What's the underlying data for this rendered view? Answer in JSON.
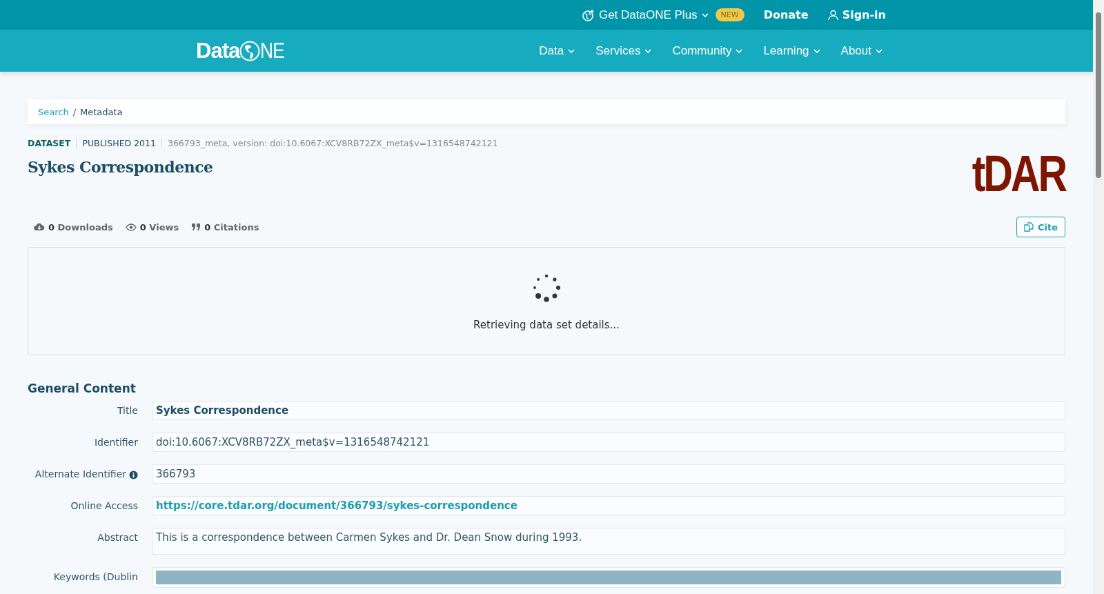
{
  "top_bar": {
    "plus": {
      "label": "Get DataONE Plus",
      "badge": "NEW"
    },
    "donate": "Donate",
    "sign_in": "Sign-in"
  },
  "logo": {
    "left": "Data",
    "right": "NE"
  },
  "nav": [
    {
      "label": "Data"
    },
    {
      "label": "Services"
    },
    {
      "label": "Community"
    },
    {
      "label": "Learning"
    },
    {
      "label": "About"
    }
  ],
  "breadcrumb": {
    "separator": "/",
    "items": [
      {
        "label": "Search",
        "link": true
      },
      {
        "label": "Metadata",
        "link": false
      }
    ]
  },
  "meta": {
    "type": "DATASET",
    "published": "PUBLISHED 2011",
    "version": "366793_meta, version: doi:10.6067:XCV8RB72ZX_meta$v=1316548742121"
  },
  "title": "Sykes Correspondence",
  "repository_logo": "tDAR",
  "stats": [
    {
      "kind": "downloads",
      "count": "0",
      "label": "Downloads"
    },
    {
      "kind": "views",
      "count": "0",
      "label": "Views"
    },
    {
      "kind": "citations",
      "count": "0",
      "label": "Citations"
    }
  ],
  "cite_button": "Cite",
  "loading": {
    "message": "Retrieving data set details..."
  },
  "section": {
    "heading": "General Content",
    "fields": [
      {
        "label": "Title",
        "value": "Sykes Correspondence",
        "kind": "bold"
      },
      {
        "label": "Identifier",
        "value": "doi:10.6067:XCV8RB72ZX_meta$v=1316548742121",
        "kind": "text"
      },
      {
        "label": "Alternate Identifier",
        "value": "366793",
        "kind": "text",
        "info": true
      },
      {
        "label": "Online Access",
        "value": "https://core.tdar.org/document/366793/sykes-correspondence",
        "kind": "link"
      },
      {
        "label": "Abstract",
        "value": "This is a correspondence between Carmen Sykes and Dr. Dean Snow during 1993.",
        "kind": "long"
      },
      {
        "label": "Keywords (Dublin",
        "kind": "bar"
      }
    ]
  }
}
